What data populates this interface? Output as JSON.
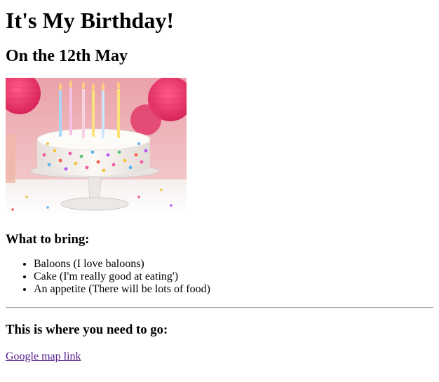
{
  "page": {
    "title": "It's My Birthday!",
    "date": "On the 12th May"
  },
  "image": {
    "subject": "birthday-cake-with-candles"
  },
  "bring": {
    "heading": "What to bring:",
    "items": [
      "Baloons (I love baloons)",
      "Cake (I'm really good at eating')",
      "An appetite (There will be lots of food)"
    ]
  },
  "directions": {
    "heading": "This is where you need to go:",
    "link_label": "Google map link"
  },
  "colors": {
    "link_visited": "#551a8b",
    "hr": "#9a9a9a",
    "cake_bg": "#e8a0a8",
    "lantern": "#e8356b"
  }
}
